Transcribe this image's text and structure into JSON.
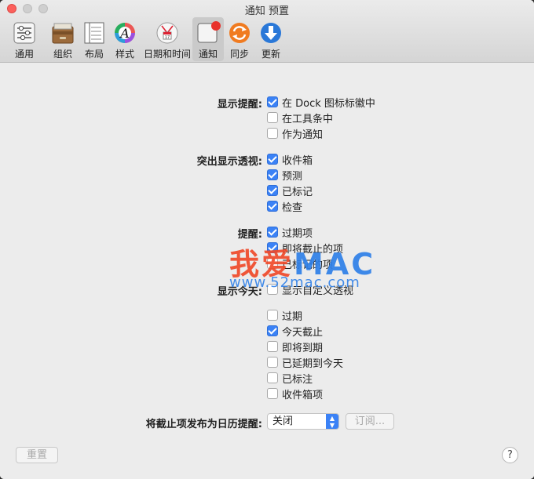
{
  "window": {
    "title": "通知 预置"
  },
  "toolbar": {
    "items": [
      {
        "label": "通用"
      },
      {
        "label": "组织"
      },
      {
        "label": "布局"
      },
      {
        "label": "样式"
      },
      {
        "label": "日期和时间"
      },
      {
        "label": "通知"
      },
      {
        "label": "同步"
      },
      {
        "label": "更新"
      }
    ]
  },
  "sections": {
    "display_alert": {
      "label": "显示提醒:",
      "options": [
        {
          "label": "在 Dock 图标标徽中",
          "checked": true
        },
        {
          "label": "在工具条中",
          "checked": false
        },
        {
          "label": "作为通知",
          "checked": false
        }
      ]
    },
    "highlight_perspectives": {
      "label": "突出显示透视:",
      "options": [
        {
          "label": "收件箱",
          "checked": true
        },
        {
          "label": "预测",
          "checked": true
        },
        {
          "label": "已标记",
          "checked": true
        },
        {
          "label": "检查",
          "checked": true
        }
      ]
    },
    "reminder": {
      "label": "提醒:",
      "options": [
        {
          "label": "过期项",
          "checked": true
        },
        {
          "label": "即将截止的项",
          "checked": true
        },
        {
          "label": "已标记的项",
          "checked": false
        }
      ]
    },
    "show_today": {
      "label": "显示今天:",
      "options": [
        {
          "label": "显示自定义透视",
          "checked": false
        },
        {
          "label": "过期",
          "checked": false
        },
        {
          "label": "今天截止",
          "checked": true
        },
        {
          "label": "即将到期",
          "checked": false
        },
        {
          "label": "已延期到今天",
          "checked": false
        },
        {
          "label": "已标注",
          "checked": false
        },
        {
          "label": "收件箱项",
          "checked": false
        }
      ]
    },
    "calendar": {
      "label": "将截止项发布为日历提醒:",
      "select_value": "关闭",
      "subscribe_label": "订阅..."
    }
  },
  "footer": {
    "reset_label": "重置",
    "help_label": "?"
  },
  "watermark": {
    "brand_a": "我爱",
    "brand_b": "MAC",
    "url": "www.52mac.com"
  },
  "colors": {
    "accent": "#3b82f6",
    "close": "#fc605c"
  }
}
